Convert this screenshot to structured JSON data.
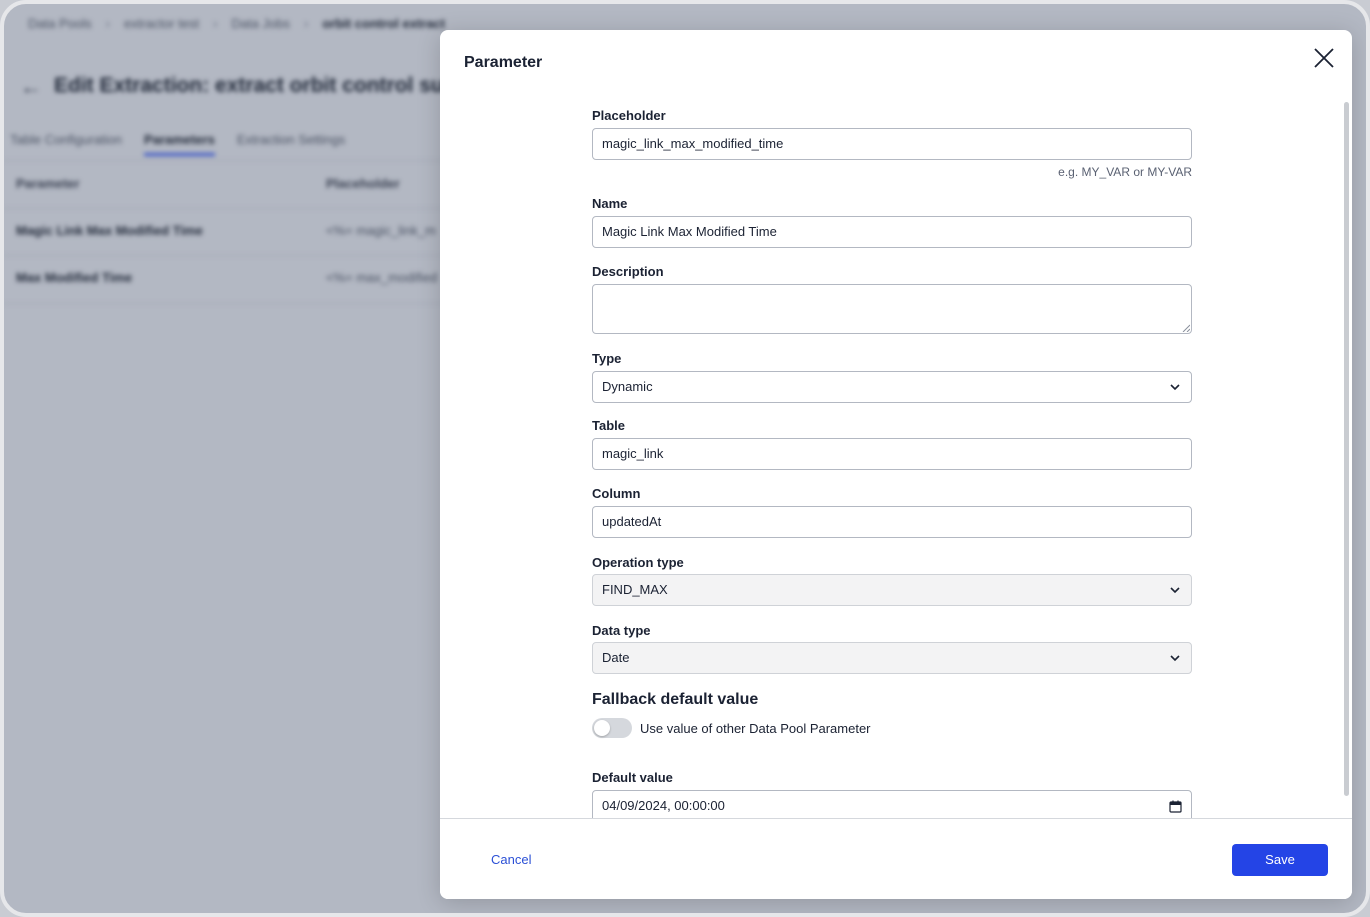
{
  "background": {
    "breadcrumbs": [
      "Data Pools",
      "extractor test",
      "Data Jobs",
      "orbit control extract"
    ],
    "page_title": "Edit Extraction: extract orbit control sub",
    "tabs": [
      "Table Configuration",
      "Parameters",
      "Extraction Settings"
    ],
    "active_tab": "Parameters",
    "columns": [
      "Parameter",
      "Placeholder"
    ],
    "rows": [
      {
        "parameter": "Magic Link Max Modified Time",
        "placeholder": "<%= magic_link_m"
      },
      {
        "parameter": "Max Modified Time",
        "placeholder": "<%= max_modified"
      }
    ]
  },
  "modal": {
    "title": "Parameter",
    "fields": {
      "placeholder": {
        "label": "Placeholder",
        "value": "magic_link_max_modified_time",
        "hint": "e.g. MY_VAR or MY-VAR"
      },
      "name": {
        "label": "Name",
        "value": "Magic Link Max Modified Time"
      },
      "description": {
        "label": "Description",
        "value": ""
      },
      "type": {
        "label": "Type",
        "value": "Dynamic"
      },
      "table": {
        "label": "Table",
        "value": "magic_link"
      },
      "column": {
        "label": "Column",
        "value": "updatedAt"
      },
      "operation_type": {
        "label": "Operation type",
        "value": "FIND_MAX"
      },
      "data_type": {
        "label": "Data type",
        "value": "Date"
      }
    },
    "fallback": {
      "title": "Fallback default value",
      "toggle_label": "Use value of other Data Pool Parameter",
      "toggle_on": false
    },
    "default_value": {
      "label": "Default value",
      "value": "04/09/2024, 00:00:00"
    },
    "footer": {
      "cancel_label": "Cancel",
      "save_label": "Save"
    }
  },
  "colors": {
    "accent": "#2444e6",
    "link": "#2b50d6"
  }
}
